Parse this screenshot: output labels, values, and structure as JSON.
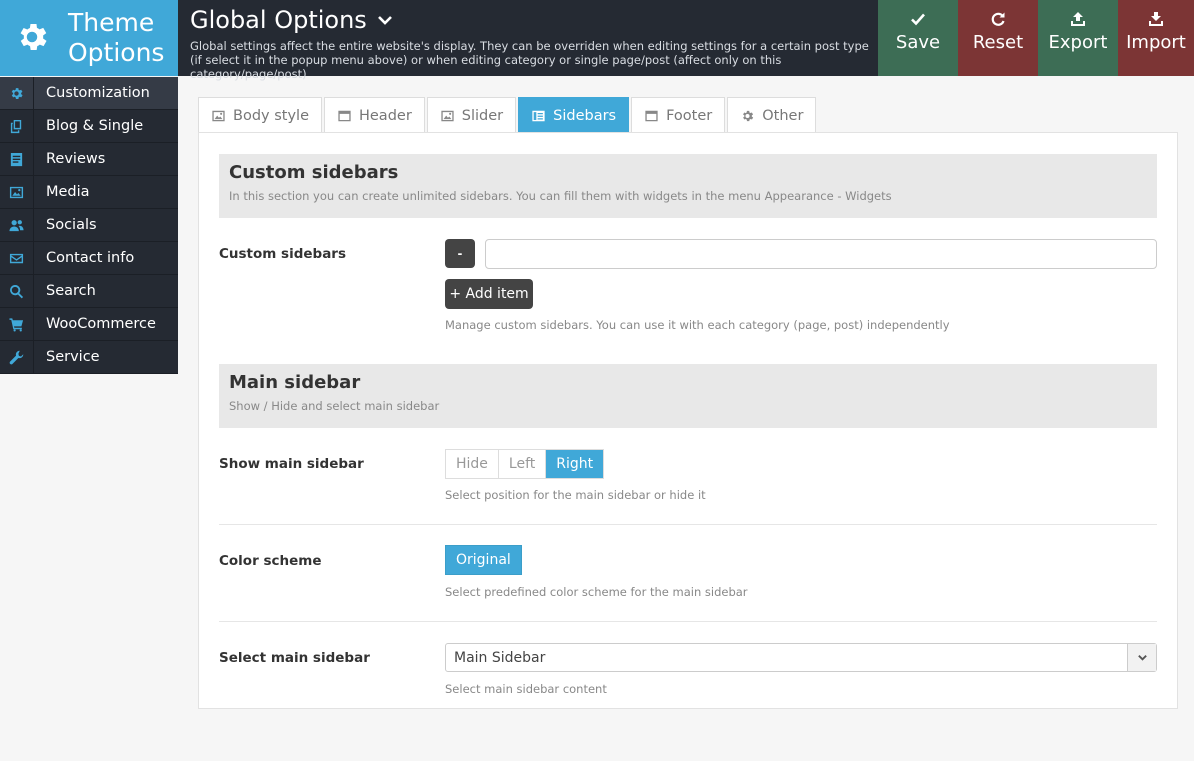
{
  "brand": {
    "title_line1": "Theme",
    "title_line2": "Options",
    "icon": "gear-icon"
  },
  "header": {
    "title": "Global Options",
    "description": "Global settings affect the entire website's display. They can be overriden when editing settings for a certain post type (if select it in the popup menu above) or when editing category or single page/post (affect only on this category/page/post)"
  },
  "actions": {
    "save": "Save",
    "reset": "Reset",
    "export": "Export",
    "import": "Import"
  },
  "colors": {
    "accent": "#40a8d8",
    "dark": "#252a33",
    "save": "#3d6d55",
    "reset": "#7c3535"
  },
  "menu": [
    {
      "label": "Customization",
      "icon": "gear-icon"
    },
    {
      "label": "Blog & Single",
      "icon": "copy-icon"
    },
    {
      "label": "Reviews",
      "icon": "document-icon"
    },
    {
      "label": "Media",
      "icon": "image-icon"
    },
    {
      "label": "Socials",
      "icon": "users-icon"
    },
    {
      "label": "Contact info",
      "icon": "envelope-icon"
    },
    {
      "label": "Search",
      "icon": "search-icon"
    },
    {
      "label": "WooCommerce",
      "icon": "cart-icon"
    },
    {
      "label": "Service",
      "icon": "wrench-icon"
    }
  ],
  "tabs": [
    {
      "label": "Body style",
      "icon": "image-icon"
    },
    {
      "label": "Header",
      "icon": "window-icon"
    },
    {
      "label": "Slider",
      "icon": "image-icon"
    },
    {
      "label": "Sidebars",
      "icon": "list-icon"
    },
    {
      "label": "Footer",
      "icon": "window-icon"
    },
    {
      "label": "Other",
      "icon": "gear-icon"
    }
  ],
  "active_tab": "Sidebars",
  "custom_sidebars": {
    "section_title": "Custom sidebars",
    "section_desc": "In this section you can create unlimited sidebars. You can fill them with widgets in the menu Appearance - Widgets",
    "field_label": "Custom sidebars",
    "remove_label": "-",
    "input_value": "",
    "add_label": "+ Add item",
    "field_desc": "Manage custom sidebars. You can use it with each category (page, post) independently"
  },
  "main_sidebar": {
    "section_title": "Main sidebar",
    "section_desc": "Show / Hide and select main sidebar",
    "show_label": "Show main sidebar",
    "show_options": [
      "Hide",
      "Left",
      "Right"
    ],
    "show_selected": "Right",
    "show_desc": "Select position for the main sidebar or hide it",
    "color_label": "Color scheme",
    "color_value": "Original",
    "color_desc": "Select predefined color scheme for the main sidebar",
    "select_label": "Select main sidebar",
    "select_value": "Main Sidebar",
    "select_desc": "Select main sidebar content"
  }
}
